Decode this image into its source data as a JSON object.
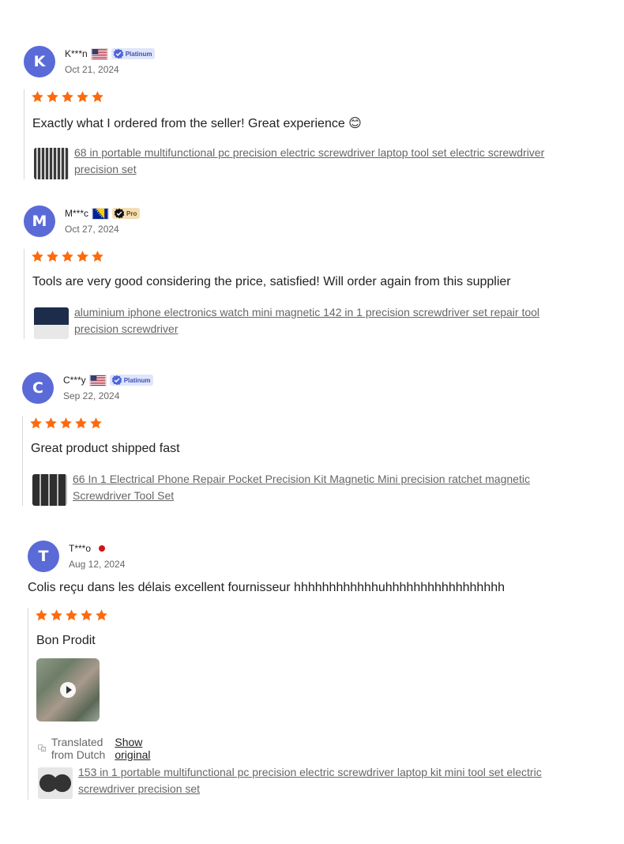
{
  "reviews": [
    {
      "initial": "K",
      "name": "K***n",
      "flag": "us",
      "badge": "Platinum",
      "date": "Oct 21, 2024",
      "rating": 5,
      "text": "Exactly what I ordered from the seller! Great experience 😊",
      "product_line1": "68 in portable multifunctional pc precision electric screwdriver laptop tool set electric screwdriver",
      "product_line2": "precision set"
    },
    {
      "initial": "M",
      "name": "M***c",
      "flag": "ba",
      "badge": "Pro",
      "date": "Oct 27, 2024",
      "rating": 5,
      "text": "Tools are very good considering the price, satisfied! Will order again from this supplier",
      "product_line1": "aluminium iphone electronics watch mini magnetic 142 in 1 precision screwdriver set repair tool",
      "product_line2": "precision screwdriver"
    },
    {
      "initial": "C",
      "name": "C***y",
      "flag": "us",
      "badge": "Platinum",
      "date": "Sep 22, 2024",
      "rating": 5,
      "text": "Great product shipped fast",
      "product_line1": "66 In 1 Electrical Phone Repair Pocket Precision Kit Magnetic Mini precision ratchet magnetic",
      "product_line2": "Screwdriver Tool Set"
    },
    {
      "initial": "T",
      "name": "T***o",
      "date": "Aug 12, 2024",
      "seller_reply": "Colis reçu dans les délais excellent fournisseur hhhhhhhhhhhhuhhhhhhhhhhhhhhhhh",
      "rating": 5,
      "text": "Bon Prodit",
      "translated_label": "Translated from Dutch",
      "show_original": "Show original",
      "product_line1": "153 in 1 portable multifunctional pc precision electric screwdriver laptop kit mini tool set electric",
      "product_line2": "screwdriver precision set"
    }
  ],
  "colors": {
    "avatar": "#5a6bd8",
    "star": "#fd6a0d",
    "link": "#666666"
  }
}
